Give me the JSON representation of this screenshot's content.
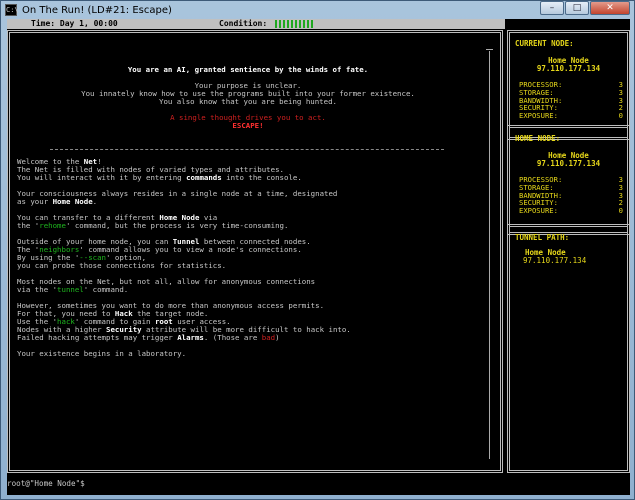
{
  "window": {
    "title": "On The Run! (LD#21: Escape)",
    "icon_text": "C:\\",
    "minimize": "–",
    "maximize": "□",
    "close": "✕"
  },
  "status": {
    "time": "Time: Day 1, 00:00",
    "condition": "Condition:",
    "condition_bars": 10,
    "condition_color": "#1fa81f"
  },
  "intro": {
    "line1": "You are an AI, granted sentience by the winds of fate.",
    "line2": "Your purpose is unclear.",
    "line3": "You innately know how to use the programs built into your former existence.",
    "line4": "You also know that you are being hunted.",
    "line5": "A single thought drives you to act.",
    "line6": "ESCAPE!"
  },
  "body": {
    "p1a": "Welcome to the ",
    "p1b": "Net",
    "p1c": "!",
    "p2": "The Net is filled with nodes of varied types and attributes.",
    "p3a": "You will interact with it by entering ",
    "p3b": "commands",
    "p3c": " into the console.",
    "p4": "Your consciousness always resides in a single node at a time, designated",
    "p5a": "as your ",
    "p5b": "Home Node",
    "p5c": ".",
    "p6a": "You can transfer to a different ",
    "p6b": "Home Node",
    "p6c": " via",
    "p7a": "the '",
    "p7b": "rehome",
    "p7c": "' command, but the process is very time-consuming.",
    "p8a": "Outside of your home node, you can ",
    "p8b": "Tunnel",
    "p8c": " between connected nodes.",
    "p9a": "The '",
    "p9b": "neighbors",
    "p9c": "' command allows you to view a node's connections.",
    "p10a": "By using the '",
    "p10b": "--scan",
    "p10c": "' option,",
    "p11": "you can probe those connections for statistics.",
    "p12": "Most nodes on the Net, but not all, allow for anonymous connections",
    "p13a": "via the '",
    "p13b": "tunnel",
    "p13c": "' command.",
    "p14": "However, sometimes you want to do more than anonymous access permits.",
    "p15a": "For that, you need to ",
    "p15b": "Hack",
    "p15c": " the target node.",
    "p16a": "Use the '",
    "p16b": "hack",
    "p16c": "' command to gain ",
    "p16d": "root",
    "p16e": " user access.",
    "p17a": "Nodes with a higher ",
    "p17b": "Security",
    "p17c": " attribute will be more difficult to hack into.",
    "p18a": "Failed hacking attempts may trigger ",
    "p18b": "Alarms",
    "p18c": ". (Those are ",
    "p18d": "bad",
    "p18e": ")",
    "p19": "Your existence begins in a laboratory."
  },
  "current_node": {
    "header": "CURRENT NODE:",
    "name": "Home Node",
    "ip": "97.110.177.134",
    "stats": [
      {
        "label": "PROCESSOR:",
        "value": "3"
      },
      {
        "label": "STORAGE:",
        "value": "3"
      },
      {
        "label": "BANDWIDTH:",
        "value": "3"
      },
      {
        "label": "SECURITY:",
        "value": "2"
      },
      {
        "label": "EXPOSURE:",
        "value": "0"
      }
    ]
  },
  "home_node": {
    "header": "HOME NODE:",
    "name": "Home Node",
    "ip": "97.110.177.134",
    "stats": [
      {
        "label": "PROCESSOR:",
        "value": "3"
      },
      {
        "label": "STORAGE:",
        "value": "3"
      },
      {
        "label": "BANDWIDTH:",
        "value": "3"
      },
      {
        "label": "SECURITY:",
        "value": "2"
      },
      {
        "label": "EXPOSURE:",
        "value": "0"
      }
    ]
  },
  "tunnel_path": {
    "header": "TUNNEL PATH:",
    "name": "Home Node",
    "ip": "97.110.177.134"
  },
  "prompt": {
    "text": "root@\"Home Node\"$"
  },
  "colors": {
    "accent_yellow": "#e6d71a",
    "command_green": "#1eb51e",
    "danger_red": "#d02020"
  }
}
